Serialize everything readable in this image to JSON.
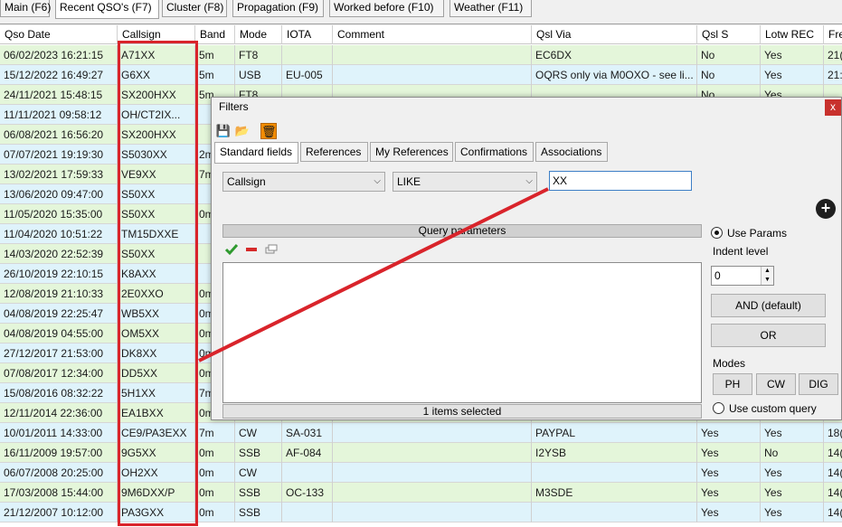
{
  "tabs": [
    "Main (F6)",
    "Recent QSO's (F7)",
    "Cluster (F8)",
    "Propagation (F9)",
    "Worked before (F10)",
    "Weather (F11)"
  ],
  "columns": [
    "Qso Date",
    "Callsign",
    "Band",
    "Mode",
    "IOTA",
    "Comment",
    "Qsl Via",
    "Qsl S",
    "Lotw REC",
    "Fre"
  ],
  "rows": [
    {
      "date": "06/02/2023 16:21:15",
      "call": "A71XX",
      "band": "5m",
      "mode": "FT8",
      "iota": "",
      "comment": "",
      "via": "EC6DX",
      "qsls": "No",
      "lotw": "Yes",
      "freq": "21("
    },
    {
      "date": "15/12/2022 16:49:27",
      "call": "G6XX",
      "band": "5m",
      "mode": "USB",
      "iota": "EU-005",
      "comment": "",
      "via": "OQRS only via M0OXO - see li...",
      "qsls": "No",
      "lotw": "Yes",
      "freq": "21:"
    },
    {
      "date": "24/11/2021 15:48:15",
      "call": "SX200HXX",
      "band": "5m",
      "mode": "FT8",
      "iota": "",
      "comment": "",
      "via": "",
      "qsls": "No",
      "lotw": "Yes",
      "freq": ""
    },
    {
      "date": "11/11/2021 09:58:12",
      "call": "OH/CT2IX...",
      "band": "",
      "mode": "",
      "iota": "",
      "comment": "",
      "via": "",
      "qsls": "",
      "lotw": "",
      "freq": ""
    },
    {
      "date": "06/08/2021 16:56:20",
      "call": "SX200HXX",
      "band": "",
      "mode": "",
      "iota": "",
      "comment": "",
      "via": "",
      "qsls": "",
      "lotw": "",
      "freq": ""
    },
    {
      "date": "07/07/2021 19:19:30",
      "call": "S5030XX",
      "band": "2m",
      "mode": "",
      "iota": "",
      "comment": "",
      "via": "",
      "qsls": "",
      "lotw": "",
      "freq": ""
    },
    {
      "date": "13/02/2021 17:59:33",
      "call": "VE9XX",
      "band": "7m",
      "mode": "",
      "iota": "",
      "comment": "",
      "via": "",
      "qsls": "",
      "lotw": "",
      "freq": ""
    },
    {
      "date": "13/06/2020 09:47:00",
      "call": "S50XX",
      "band": "",
      "mode": "",
      "iota": "",
      "comment": "",
      "via": "",
      "qsls": "",
      "lotw": "",
      "freq": ""
    },
    {
      "date": "11/05/2020 15:35:00",
      "call": "S50XX",
      "band": "0m",
      "mode": "",
      "iota": "",
      "comment": "",
      "via": "",
      "qsls": "",
      "lotw": "",
      "freq": ""
    },
    {
      "date": "11/04/2020 10:51:22",
      "call": "TM15DXXE",
      "band": "",
      "mode": "",
      "iota": "",
      "comment": "",
      "via": "",
      "qsls": "",
      "lotw": "",
      "freq": ""
    },
    {
      "date": "14/03/2020 22:52:39",
      "call": "S50XX",
      "band": "",
      "mode": "",
      "iota": "",
      "comment": "",
      "via": "",
      "qsls": "",
      "lotw": "",
      "freq": ""
    },
    {
      "date": "26/10/2019 22:10:15",
      "call": "K8AXX",
      "band": "",
      "mode": "",
      "iota": "",
      "comment": "",
      "via": "",
      "qsls": "",
      "lotw": "",
      "freq": ""
    },
    {
      "date": "12/08/2019 21:10:33",
      "call": "2E0XXO",
      "band": "0m",
      "mode": "",
      "iota": "",
      "comment": "",
      "via": "",
      "qsls": "",
      "lotw": "",
      "freq": ""
    },
    {
      "date": "04/08/2019 22:25:47",
      "call": "WB5XX",
      "band": "0m",
      "mode": "",
      "iota": "",
      "comment": "",
      "via": "",
      "qsls": "",
      "lotw": "",
      "freq": ""
    },
    {
      "date": "04/08/2019 04:55:00",
      "call": "OM5XX",
      "band": "0m",
      "mode": "",
      "iota": "",
      "comment": "",
      "via": "",
      "qsls": "",
      "lotw": "",
      "freq": ""
    },
    {
      "date": "27/12/2017 21:53:00",
      "call": "DK8XX",
      "band": "0m",
      "mode": "",
      "iota": "",
      "comment": "",
      "via": "",
      "qsls": "",
      "lotw": "",
      "freq": ""
    },
    {
      "date": "07/08/2017 12:34:00",
      "call": "DD5XX",
      "band": "0m",
      "mode": "",
      "iota": "",
      "comment": "",
      "via": "",
      "qsls": "",
      "lotw": "",
      "freq": ""
    },
    {
      "date": "15/08/2016 08:32:22",
      "call": "5H1XX",
      "band": "7m",
      "mode": "",
      "iota": "",
      "comment": "",
      "via": "",
      "qsls": "",
      "lotw": "",
      "freq": ""
    },
    {
      "date": "12/11/2014 22:36:00",
      "call": "EA1BXX",
      "band": "0m",
      "mode": "",
      "iota": "",
      "comment": "",
      "via": "",
      "qsls": "",
      "lotw": "",
      "freq": ""
    },
    {
      "date": "10/01/2011 14:33:00",
      "call": "CE9/PA3EXX",
      "band": "7m",
      "mode": "CW",
      "iota": "SA-031",
      "comment": "",
      "via": "PAYPAL",
      "qsls": "Yes",
      "lotw": "Yes",
      "freq": "18("
    },
    {
      "date": "16/11/2009 19:57:00",
      "call": "9G5XX",
      "band": "0m",
      "mode": "SSB",
      "iota": "AF-084",
      "comment": "",
      "via": "I2YSB",
      "qsls": "Yes",
      "lotw": "No",
      "freq": "14("
    },
    {
      "date": "06/07/2008 20:25:00",
      "call": "OH2XX",
      "band": "0m",
      "mode": "CW",
      "iota": "",
      "comment": "",
      "via": "",
      "qsls": "Yes",
      "lotw": "Yes",
      "freq": "14("
    },
    {
      "date": "17/03/2008 15:44:00",
      "call": "9M6DXX/P",
      "band": "0m",
      "mode": "SSB",
      "iota": "OC-133",
      "comment": "",
      "via": "M3SDE",
      "qsls": "Yes",
      "lotw": "Yes",
      "freq": "14("
    },
    {
      "date": "21/12/2007 10:12:00",
      "call": "PA3GXX",
      "band": "0m",
      "mode": "SSB",
      "iota": "",
      "comment": "",
      "via": "",
      "qsls": "Yes",
      "lotw": "Yes",
      "freq": "14("
    }
  ],
  "dialog": {
    "title": "Filters",
    "close_label": "x",
    "toolbar": {
      "save_glyph": "💾",
      "open_glyph": "📂",
      "delete_glyph": "🗑"
    },
    "tabs": [
      "Standard fields",
      "References",
      "My References",
      "Confirmations",
      "Associations"
    ],
    "field_select": "Callsign",
    "operator_select": "LIKE",
    "value_input": "XX",
    "add_glyph": "+",
    "query_params_header": "Query parameters",
    "list_status": "1 items selected",
    "use_params_label": "Use Params",
    "indent_label": "Indent level",
    "indent_value": "0",
    "and_button": "AND (default)",
    "or_button": "OR",
    "modes_label": "Modes",
    "mode_buttons": [
      "PH",
      "CW",
      "DIG"
    ],
    "custom_query_label": "Use custom query"
  },
  "colors": {
    "annotation": "#d9242b",
    "row_green": "#e4f6da",
    "row_cyan": "#dff3fb",
    "delete_icon_bg": "#f28c00"
  }
}
